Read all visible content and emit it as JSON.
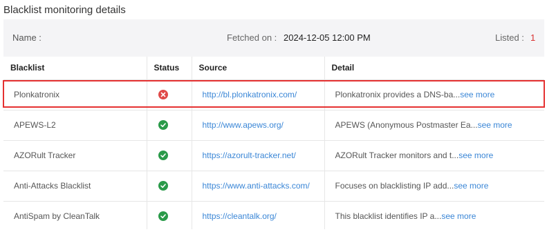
{
  "title": "Blacklist monitoring details",
  "summary": {
    "name_label": "Name :",
    "name_value": "",
    "fetched_label": "Fetched on :",
    "fetched_value": "2024-12-05 12:00 PM",
    "listed_label": "Listed :",
    "listed_value": "1"
  },
  "table": {
    "columns": [
      "Blacklist",
      "Status",
      "Source",
      "Detail"
    ],
    "see_more_label": "see more",
    "rows": [
      {
        "blacklist": "Plonkatronix",
        "status": "listed",
        "status_icon": "x-circle-icon",
        "source": "http://bl.plonkatronix.com/",
        "detail": "Plonkatronix provides a DNS-ba..."
      },
      {
        "blacklist": "APEWS-L2",
        "status": "ok",
        "status_icon": "check-circle-icon",
        "source": "http://www.apews.org/",
        "detail": "APEWS (Anonymous Postmaster Ea..."
      },
      {
        "blacklist": "AZORult Tracker",
        "status": "ok",
        "status_icon": "check-circle-icon",
        "source": "https://azorult-tracker.net/",
        "detail": "AZORult Tracker monitors and t..."
      },
      {
        "blacklist": "Anti-Attacks Blacklist",
        "status": "ok",
        "status_icon": "check-circle-icon",
        "source": "https://www.anti-attacks.com/",
        "detail": "Focuses on blacklisting IP add..."
      },
      {
        "blacklist": "AntiSpam by CleanTalk",
        "status": "ok",
        "status_icon": "check-circle-icon",
        "source": "https://cleantalk.org/",
        "detail": "This blacklist identifies IP a..."
      }
    ]
  },
  "colors": {
    "listed": "#e04a49",
    "ok": "#2a9a49",
    "link": "#3a86d6",
    "highlight": "#e53030",
    "listed_count": "#d9302f"
  }
}
